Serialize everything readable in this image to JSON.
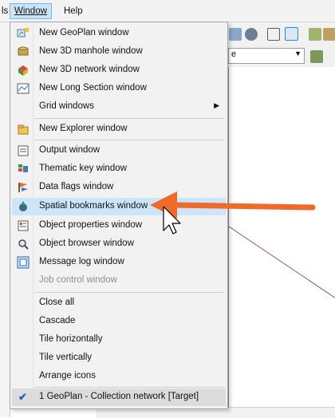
{
  "menubar": {
    "tools_fragment": "ls",
    "window_label": "Window",
    "help_label": "Help"
  },
  "background": {
    "combo_text": "e"
  },
  "menu": {
    "items": [
      {
        "label": "New GeoPlan window",
        "icon": "geoplan-icon"
      },
      {
        "label": "New 3D manhole window",
        "icon": "manhole-3d-icon"
      },
      {
        "label": "New 3D network window",
        "icon": "network-3d-icon"
      },
      {
        "label": "New Long Section window",
        "icon": "long-section-icon"
      },
      {
        "label": "Grid windows",
        "icon": "",
        "submenu": true
      },
      {
        "label": "New Explorer window",
        "icon": "explorer-icon"
      },
      {
        "label": "Output window",
        "icon": "output-icon"
      },
      {
        "label": "Thematic key window",
        "icon": "thematic-key-icon"
      },
      {
        "label": "Data flags window",
        "icon": "data-flags-icon"
      },
      {
        "label": "Spatial bookmarks window",
        "icon": "spatial-bookmarks-icon",
        "highlighted": true
      },
      {
        "label": "Object properties window",
        "icon": "object-properties-icon"
      },
      {
        "label": "Object browser window",
        "icon": "object-browser-icon"
      },
      {
        "label": "Message log window",
        "icon": "message-log-icon"
      },
      {
        "label": "Job control window",
        "icon": "",
        "disabled": true
      },
      {
        "label": "Close all"
      },
      {
        "label": "Cascade"
      },
      {
        "label": "Tile horizontally"
      },
      {
        "label": "Tile vertically"
      },
      {
        "label": "Arrange icons"
      },
      {
        "label": "1 GeoPlan - Collection network [Target]",
        "checked": true
      }
    ]
  },
  "colors": {
    "highlight": "#cde5f8",
    "arrow": "#f06a2a",
    "check": "#2166b6"
  }
}
